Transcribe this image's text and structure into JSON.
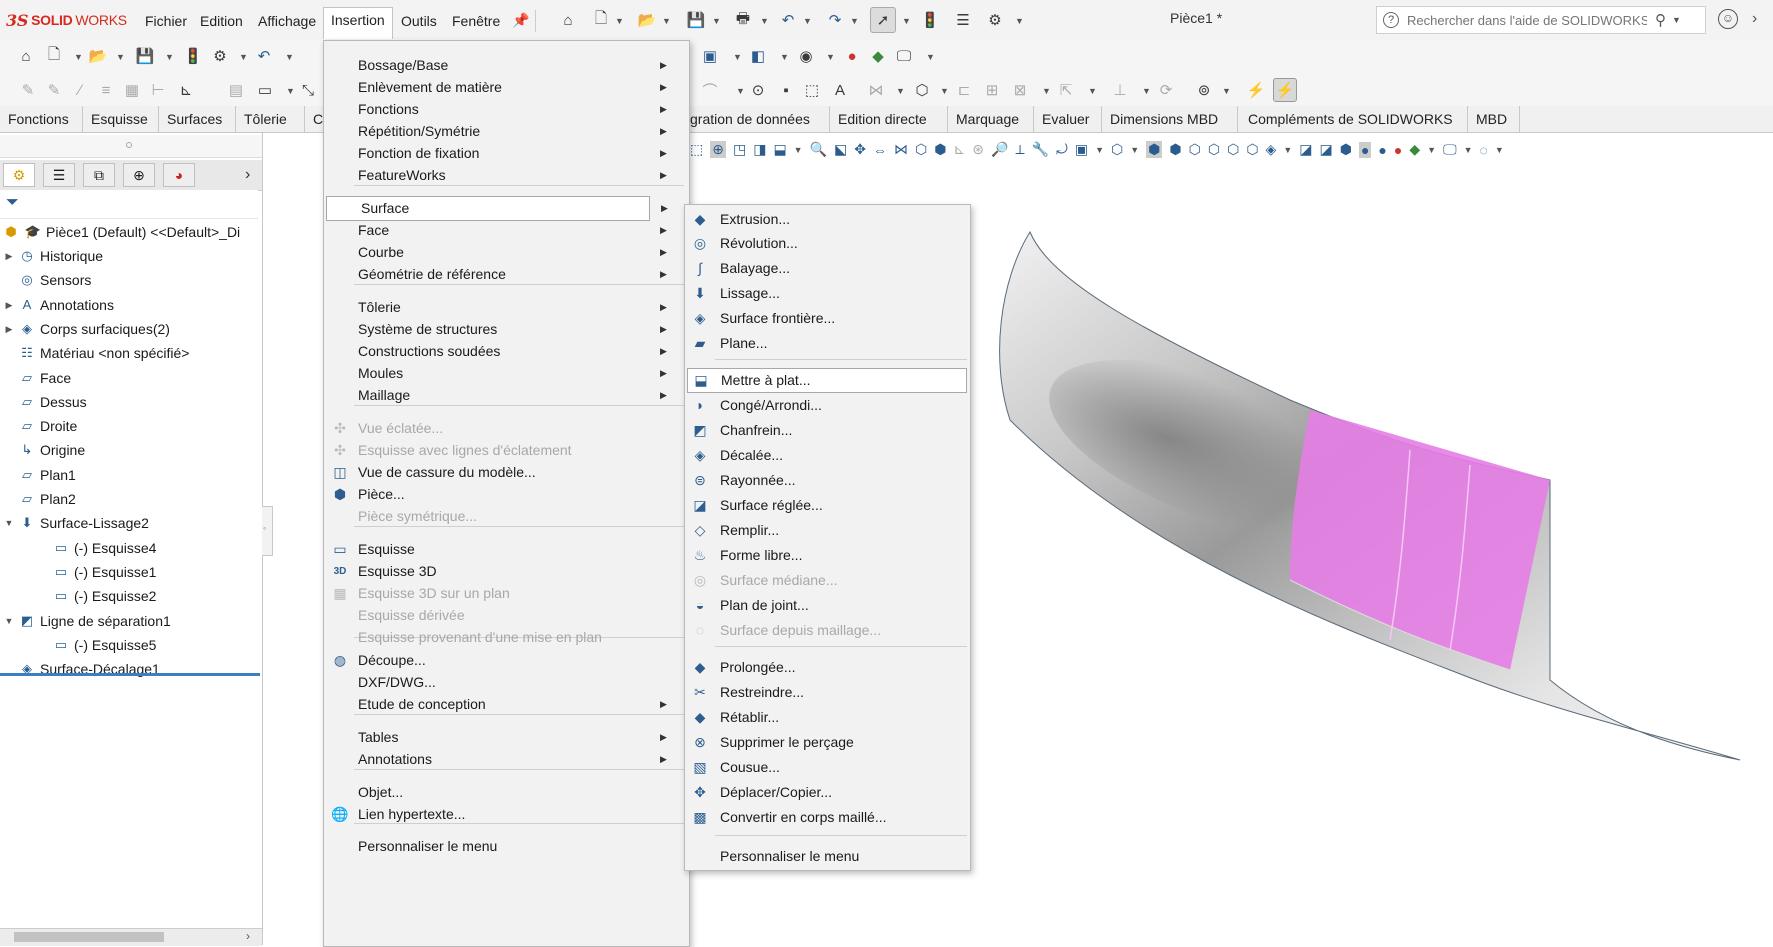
{
  "app": {
    "logo_mark": "3S",
    "logo_solid": "SOLID",
    "logo_works": "WORKS",
    "document_title": "Pièce1 *"
  },
  "menubar": {
    "items": [
      "Fichier",
      "Edition",
      "Affichage",
      "Insertion",
      "Outils",
      "Fenêtre"
    ],
    "active": "Insertion"
  },
  "search": {
    "placeholder": "Rechercher dans l'aide de SOLIDWORKS"
  },
  "command_tabs": [
    "Fonctions",
    "Esquisse",
    "Surfaces",
    "Tôlerie",
    "Co",
    "gration de données",
    "Edition directe",
    "Marquage",
    "Evaluer",
    "Dimensions MBD",
    "Compléments de SOLIDWORKS",
    "MBD"
  ],
  "feature_tree": {
    "root": "Pièce1 (Default) <<Default>_Di",
    "items": [
      {
        "label": "Historique",
        "icon": "history-icon",
        "expandable": true,
        "indent": 0
      },
      {
        "label": "Sensors",
        "icon": "sensor-icon",
        "expandable": false,
        "indent": 0
      },
      {
        "label": "Annotations",
        "icon": "annotation-icon",
        "expandable": true,
        "indent": 0
      },
      {
        "label": "Corps surfaciques(2)",
        "icon": "surface-bodies-icon",
        "expandable": true,
        "indent": 0
      },
      {
        "label": "Matériau <non spécifié>",
        "icon": "material-icon",
        "expandable": false,
        "indent": 0
      },
      {
        "label": "Face",
        "icon": "plane-icon",
        "expandable": false,
        "indent": 0
      },
      {
        "label": "Dessus",
        "icon": "plane-icon",
        "expandable": false,
        "indent": 0
      },
      {
        "label": "Droite",
        "icon": "plane-icon",
        "expandable": false,
        "indent": 0
      },
      {
        "label": "Origine",
        "icon": "origin-icon",
        "expandable": false,
        "indent": 0
      },
      {
        "label": "Plan1",
        "icon": "plane-icon",
        "expandable": false,
        "indent": 0
      },
      {
        "label": "Plan2",
        "icon": "plane-icon",
        "expandable": false,
        "indent": 0
      },
      {
        "label": "Surface-Lissage2",
        "icon": "loft-icon",
        "expandable": true,
        "expanded": true,
        "indent": 0
      },
      {
        "label": "(-) Esquisse4",
        "icon": "sketch-icon",
        "expandable": false,
        "indent": 1
      },
      {
        "label": "(-) Esquisse1",
        "icon": "sketch-icon",
        "expandable": false,
        "indent": 1
      },
      {
        "label": "(-) Esquisse2",
        "icon": "sketch-icon",
        "expandable": false,
        "indent": 1
      },
      {
        "label": "Ligne de séparation1",
        "icon": "split-line-icon",
        "expandable": true,
        "expanded": true,
        "indent": 0
      },
      {
        "label": "(-) Esquisse5",
        "icon": "sketch-icon",
        "expandable": false,
        "indent": 1
      },
      {
        "label": "Surface-Décalage1",
        "icon": "offset-surface-icon",
        "expandable": false,
        "indent": 0
      }
    ]
  },
  "insertion_menu": {
    "items": [
      {
        "label": "Bossage/Base",
        "submenu": true
      },
      {
        "label": "Enlèvement de matière",
        "submenu": true
      },
      {
        "label": "Fonctions",
        "submenu": true
      },
      {
        "label": "Répétition/Symétrie",
        "submenu": true
      },
      {
        "label": "Fonction de fixation",
        "submenu": true
      },
      {
        "label": "FeatureWorks",
        "submenu": true
      },
      {
        "label": "Surface",
        "submenu": true,
        "highlighted": true
      },
      {
        "label": "Face",
        "submenu": true
      },
      {
        "label": "Courbe",
        "submenu": true
      },
      {
        "label": "Géométrie de référence",
        "submenu": true
      },
      {
        "label": "Tôlerie",
        "submenu": true
      },
      {
        "label": "Système de structures",
        "submenu": true
      },
      {
        "label": "Constructions soudées",
        "submenu": true
      },
      {
        "label": "Moules",
        "submenu": true
      },
      {
        "label": "Maillage",
        "submenu": true
      },
      {
        "label": "Vue éclatée...",
        "disabled": true,
        "icon": "exploded-view-icon"
      },
      {
        "label": "Esquisse avec lignes d'éclatement",
        "disabled": true,
        "icon": "explode-line-icon"
      },
      {
        "label": "Vue de cassure du modèle...",
        "icon": "break-view-icon"
      },
      {
        "label": "Pièce...",
        "icon": "insert-part-icon"
      },
      {
        "label": "Pièce symétrique...",
        "disabled": true
      },
      {
        "label": "Esquisse",
        "icon": "sketch-icon"
      },
      {
        "label": "Esquisse 3D",
        "icon": "sketch-3d-icon"
      },
      {
        "label": "Esquisse 3D sur un plan",
        "disabled": true,
        "icon": "sketch-3d-plane-icon"
      },
      {
        "label": "Esquisse dérivée",
        "disabled": true
      },
      {
        "label": "Esquisse provenant d'une mise en plan",
        "disabled": true
      },
      {
        "label": "Découpe...",
        "icon": "split-icon"
      },
      {
        "label": "DXF/DWG..."
      },
      {
        "label": "Etude de conception",
        "submenu": true
      },
      {
        "label": "Tables",
        "submenu": true
      },
      {
        "label": "Annotations",
        "submenu": true
      },
      {
        "label": "Objet..."
      },
      {
        "label": "Lien hypertexte...",
        "icon": "hyperlink-icon"
      },
      {
        "label": "Personnaliser le menu"
      }
    ]
  },
  "surface_submenu": {
    "items": [
      {
        "label": "Extrusion...",
        "icon": "surface-extrude-icon"
      },
      {
        "label": "Révolution...",
        "icon": "surface-revolve-icon"
      },
      {
        "label": "Balayage...",
        "icon": "surface-sweep-icon"
      },
      {
        "label": "Lissage...",
        "icon": "surface-loft-icon"
      },
      {
        "label": "Surface frontière...",
        "icon": "boundary-surface-icon"
      },
      {
        "label": "Plane...",
        "icon": "planar-surface-icon"
      },
      {
        "label": "Mettre à plat...",
        "icon": "surface-flatten-icon",
        "highlighted": true
      },
      {
        "label": "Congé/Arrondi...",
        "icon": "fillet-icon"
      },
      {
        "label": "Chanfrein...",
        "icon": "chamfer-icon"
      },
      {
        "label": "Décalée...",
        "icon": "offset-surface-icon"
      },
      {
        "label": "Rayonnée...",
        "icon": "radiate-surface-icon"
      },
      {
        "label": "Surface réglée...",
        "icon": "ruled-surface-icon"
      },
      {
        "label": "Remplir...",
        "icon": "fill-surface-icon"
      },
      {
        "label": "Forme libre...",
        "icon": "freeform-icon"
      },
      {
        "label": "Surface médiane...",
        "icon": "mid-surface-icon",
        "disabled": true
      },
      {
        "label": "Plan de joint...",
        "icon": "parting-surface-icon"
      },
      {
        "label": "Surface depuis maillage...",
        "icon": "surface-from-mesh-icon",
        "disabled": true
      },
      {
        "label": "Prolongée...",
        "icon": "extend-surface-icon"
      },
      {
        "label": "Restreindre...",
        "icon": "trim-surface-icon"
      },
      {
        "label": "Rétablir...",
        "icon": "untrim-surface-icon"
      },
      {
        "label": "Supprimer le perçage",
        "icon": "delete-hole-icon"
      },
      {
        "label": "Cousue...",
        "icon": "knit-surface-icon"
      },
      {
        "label": "Déplacer/Copier...",
        "icon": "move-copy-icon"
      },
      {
        "label": "Convertir en corps maillé...",
        "icon": "convert-mesh-icon"
      },
      {
        "label": "Personnaliser le menu"
      }
    ]
  },
  "colors": {
    "highlight_face": "#e67de6",
    "brand_red": "#d52b1e",
    "tree_selection_line": "#3a7fc1"
  }
}
